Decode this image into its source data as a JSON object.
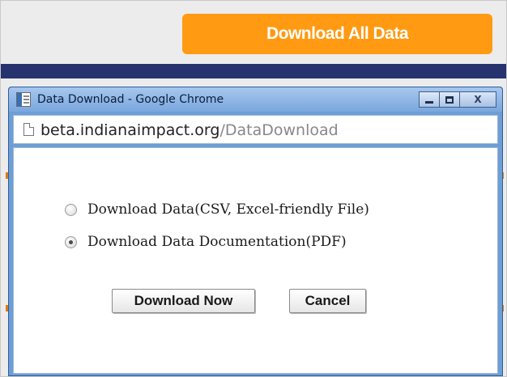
{
  "page": {
    "download_all_label": "Download All Data",
    "colors": {
      "accent": "#ff9a12",
      "navy": "#27336f"
    }
  },
  "window": {
    "title": "Data Download - Google Chrome",
    "controls": {
      "minimize": "minimize-icon",
      "maximize": "maximize-icon",
      "close": "X"
    }
  },
  "address": {
    "host": "beta.indianaimpact.org",
    "path": "/DataDownload"
  },
  "dialog": {
    "options": [
      {
        "label": "Download Data(CSV, Excel-friendly File)",
        "selected": false
      },
      {
        "label": "Download Data Documentation(PDF)",
        "selected": true
      }
    ],
    "buttons": {
      "download_now": "Download Now",
      "cancel": "Cancel"
    }
  }
}
